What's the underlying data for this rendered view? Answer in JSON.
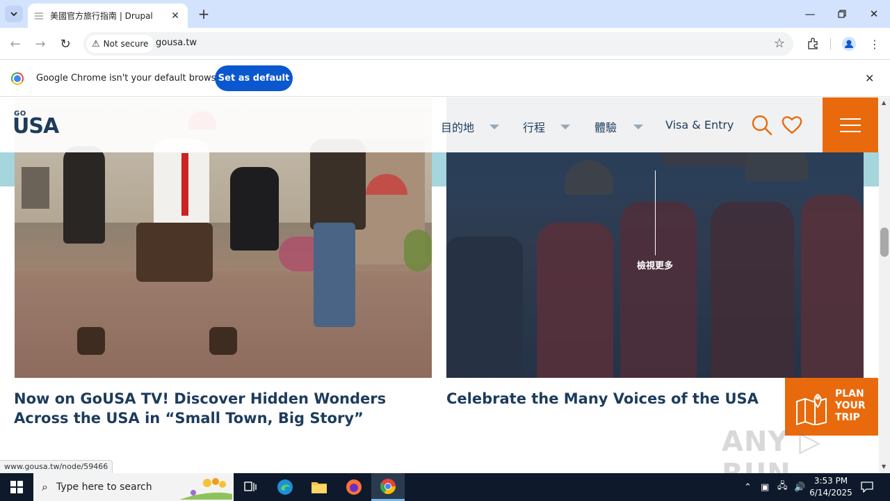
{
  "browser": {
    "tab_title": "美國官方旅行指南 | Drupal",
    "security_label": "Not secure",
    "url": "gousa.tw",
    "infobar_message": "Google Chrome isn't your default browser",
    "set_default_label": "Set as default",
    "status_url": "www.gousa.tw/node/59466"
  },
  "site": {
    "logo_go": "GO",
    "logo_usa": "USA",
    "nav": [
      {
        "label": "目的地"
      },
      {
        "label": "行程"
      },
      {
        "label": "體驗"
      },
      {
        "label": "Visa & Entry"
      }
    ],
    "accent_color": "#e86a0d",
    "text_color": "#1d3c5c"
  },
  "cards": [
    {
      "title": "Now on GoUSA TV! Discover Hidden Wonders Across the USA in “Small Town, Big Story”"
    },
    {
      "title": "Celebrate the Many Voices of the USA",
      "hover_label": "檢視更多"
    }
  ],
  "plan_trip": {
    "line1": "PLAN",
    "line2": "YOUR",
    "line3": "TRIP"
  },
  "watermark": "ANY RUN",
  "taskbar": {
    "search_placeholder": "Type here to search",
    "time": "3:53 PM",
    "date": "6/14/2025"
  }
}
